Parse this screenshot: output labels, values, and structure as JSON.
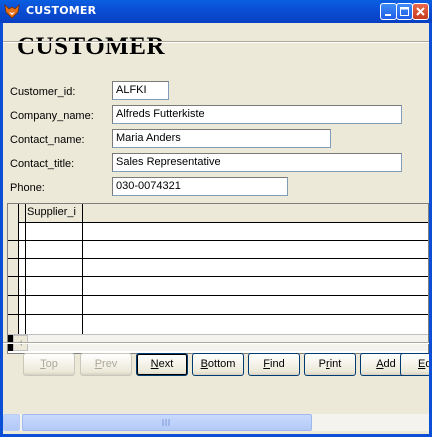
{
  "window": {
    "title": "CUSTOMER"
  },
  "form": {
    "heading": "CUSTOMER",
    "fields": [
      {
        "label": "Customer_id:",
        "value": "ALFKI"
      },
      {
        "label": "Company_name:",
        "value": "Alfreds Futterkiste"
      },
      {
        "label": "Contact_name:",
        "value": "Maria Anders"
      },
      {
        "label": "Contact_title:",
        "value": "Sales Representative"
      },
      {
        "label": "Phone:",
        "value": "030-0074321"
      }
    ]
  },
  "grid": {
    "columns": [
      "Supplier_i"
    ]
  },
  "buttons": {
    "top": {
      "pre": "",
      "key": "T",
      "post": "op"
    },
    "prev": {
      "pre": "",
      "key": "P",
      "post": "rev"
    },
    "next": {
      "pre": "",
      "key": "N",
      "post": "ext"
    },
    "bottom": {
      "pre": "",
      "key": "B",
      "post": "ottom"
    },
    "find": {
      "pre": "",
      "key": "F",
      "post": "ind"
    },
    "print": {
      "pre": "P",
      "key": "r",
      "post": "int"
    },
    "add": {
      "pre": "",
      "key": "A",
      "post": "dd"
    },
    "edit": {
      "pre": "",
      "key": "E",
      "post": "d"
    }
  },
  "icons": {
    "app": "fox-icon",
    "minimize": "minimize-icon",
    "maximize": "maximize-icon",
    "close": "close-icon"
  },
  "colors": {
    "titlebar": "#0a4fd6",
    "face": "#ece9d8",
    "close": "#c7391c"
  }
}
